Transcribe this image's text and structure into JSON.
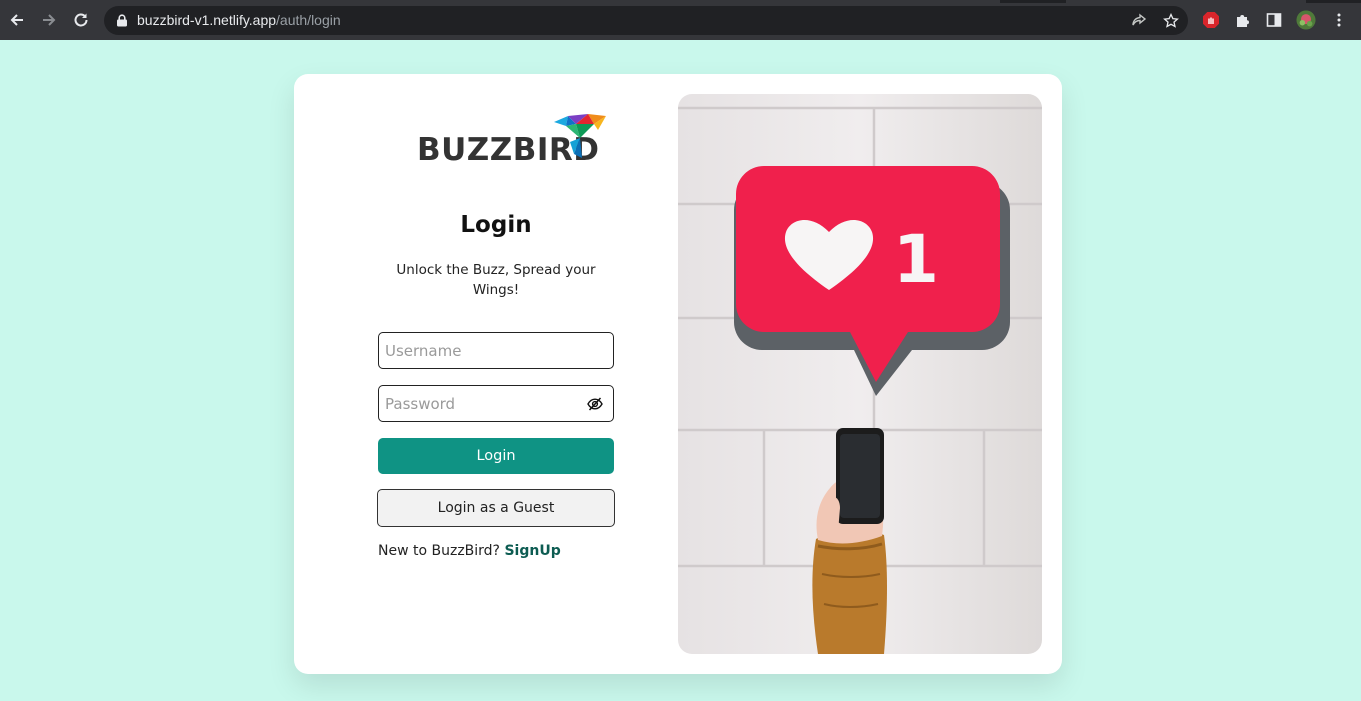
{
  "browser": {
    "url_host": "buzzbird-v1.netlify.app",
    "url_path": "/auth/login"
  },
  "logo": {
    "text": "BUZZBIRD"
  },
  "login": {
    "title": "Login",
    "subtitle": "Unlock the Buzz, Spread your Wings!",
    "username_placeholder": "Username",
    "password_placeholder": "Password",
    "login_button": "Login",
    "guest_button": "Login as a Guest",
    "signup_prompt": "New to BuzzBird?",
    "signup_link": "SignUp"
  },
  "hero": {
    "notification_count": "1"
  },
  "colors": {
    "page_background": "#c9f8ec",
    "primary": "#0f9384",
    "link": "#0d5c52",
    "notification": "#f0204c"
  }
}
